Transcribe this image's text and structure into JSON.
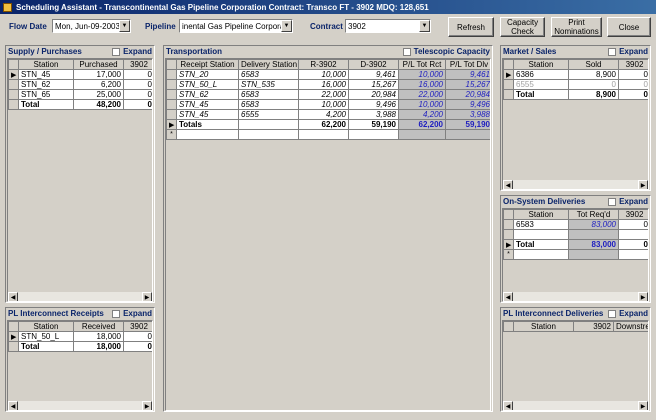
{
  "window": {
    "title": "Scheduling Assistant - Transcontinental Gas Pipeline Corporation Contract: Transco FT - 3902  MDQ: 128,651"
  },
  "toolbar": {
    "flow_date_label": "Flow Date",
    "flow_date_value": "Mon, Jun-09-2003",
    "pipeline_label": "Pipeline",
    "pipeline_value": "inental Gas Pipeline Corporation",
    "contract_label": "Contract",
    "contract_value": "3902",
    "refresh_label": "Refresh",
    "capacity_check_label": "Capacity Check",
    "print_nominations_label": "Print Nominations",
    "close_label": "Close"
  },
  "supply": {
    "title": "Supply / Purchases",
    "expand_label": "Expand",
    "columns": [
      "Station",
      "Purchased",
      "3902"
    ],
    "rows": [
      {
        "station": "STN_45",
        "purchased": "17,000",
        "c3902": "0"
      },
      {
        "station": "STN_62",
        "purchased": "6,200",
        "c3902": "0"
      },
      {
        "station": "STN_65",
        "purchased": "25,000",
        "c3902": "0"
      }
    ],
    "total": {
      "label": "Total",
      "purchased": "48,200",
      "c3902": "0"
    }
  },
  "pl_receipts": {
    "title": "PL Interconnect Receipts",
    "expand_label": "Expand",
    "columns": [
      "Station",
      "Received",
      "3902"
    ],
    "rows": [
      {
        "station": "STN_50_L",
        "received": "18,000",
        "c3902": "0"
      }
    ],
    "total": {
      "label": "Total",
      "received": "18,000",
      "c3902": "0"
    }
  },
  "transportation": {
    "title": "Transportation",
    "telescopic_label": "Telescopic Capacity",
    "columns": [
      "Receipt Station",
      "Delivery Station",
      "R-3902",
      "D-3902",
      "P/L Tot Rct",
      "P/L Tot Dlv"
    ],
    "rows": [
      {
        "receipt": "STN_20",
        "delivery": "6583",
        "r": "10,000",
        "d": "9,461",
        "rct": "10,000",
        "dlv": "9,461"
      },
      {
        "receipt": "STN_50_L",
        "delivery": "STN_535",
        "r": "16,000",
        "d": "15,267",
        "rct": "16,000",
        "dlv": "15,267"
      },
      {
        "receipt": "STN_62",
        "delivery": "6583",
        "r": "22,000",
        "d": "20,984",
        "rct": "22,000",
        "dlv": "20,984"
      },
      {
        "receipt": "STN_45",
        "delivery": "6583",
        "r": "10,000",
        "d": "9,496",
        "rct": "10,000",
        "dlv": "9,496"
      },
      {
        "receipt": "STN_45",
        "delivery": "6555",
        "r": "4,200",
        "d": "3,988",
        "rct": "4,200",
        "dlv": "3,988"
      }
    ],
    "total": {
      "label": "Totals",
      "r": "62,200",
      "d": "59,190",
      "rct": "62,200",
      "dlv": "59,190"
    },
    "new_row_marker": "*"
  },
  "market": {
    "title": "Market / Sales",
    "expand_label": "Expand",
    "columns": [
      "Station",
      "Sold",
      "3902"
    ],
    "rows": [
      {
        "station": "6386",
        "sold": "8,900",
        "c3902": "0"
      },
      {
        "station": "6555",
        "sold": "0",
        "c3902": "0"
      }
    ],
    "total": {
      "label": "Total",
      "sold": "8,900",
      "c3902": "0"
    }
  },
  "onsystem": {
    "title": "On-System Deliveries",
    "expand_label": "Expand",
    "columns": [
      "Station",
      "Tot Req'd",
      "3902"
    ],
    "rows": [
      {
        "station": "6583",
        "req": "83,000",
        "c3902": "0"
      }
    ],
    "total": {
      "label": "Total",
      "req": "83,000",
      "c3902": "0"
    },
    "new_row_marker": "*"
  },
  "pl_deliveries": {
    "title": "PL Interconnect Deliveries",
    "expand_label": "Expand",
    "columns": [
      "Station",
      "3902",
      "Downstream"
    ]
  },
  "colors": {
    "title_start": "#0a246a",
    "title_end": "#3a6ea5",
    "panel_title": "#0a246a",
    "value_blue": "#2020c0"
  },
  "icons": {
    "row_selector": "▶",
    "new_row": "*",
    "dropdown": "▼",
    "scroll_left": "◀",
    "scroll_right": "▶"
  }
}
